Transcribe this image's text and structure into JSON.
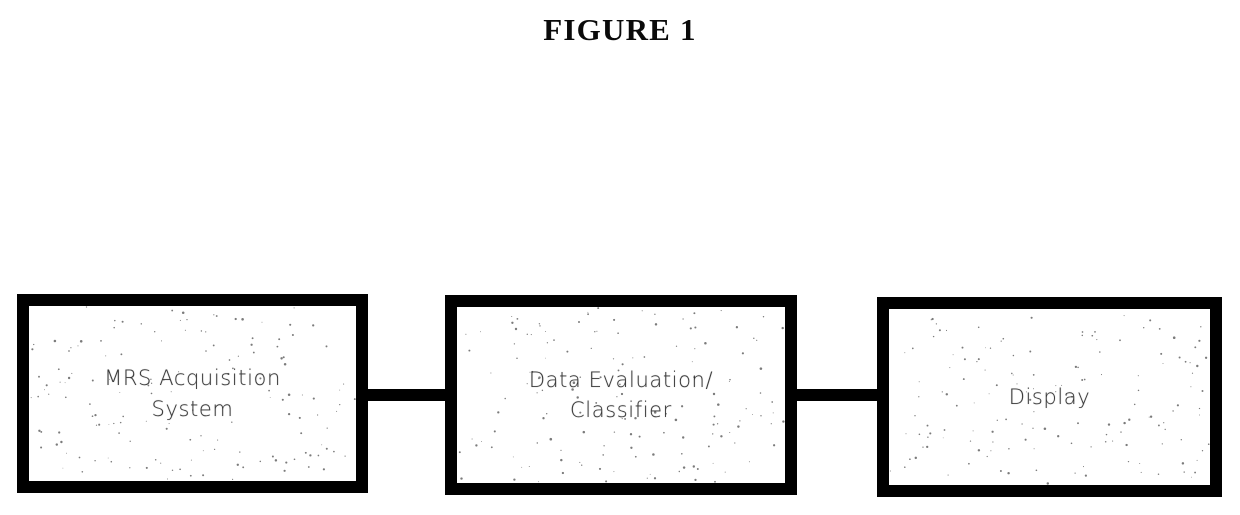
{
  "figure": {
    "title": "FIGURE 1",
    "kind": "block-diagram",
    "background_color": "#ffffff",
    "line_color": "#000000",
    "text_color": "#2b2b2b"
  },
  "chart_data": {
    "type": "diagram",
    "title": "FIGURE 1",
    "nodes": [
      {
        "id": "mrs",
        "label": "MRS Acquisition\nSystem",
        "order": 1
      },
      {
        "id": "evaluator",
        "label": "Data Evaluation/\nClassifier",
        "order": 2
      },
      {
        "id": "display",
        "label": "Display",
        "order": 3
      }
    ],
    "edges": [
      {
        "id": "connector-1",
        "from": "mrs",
        "to": "evaluator",
        "style": "thick-line",
        "arrow": false
      },
      {
        "id": "connector-2",
        "from": "evaluator",
        "to": "display",
        "style": "thick-line",
        "arrow": false
      }
    ]
  },
  "blocks": {
    "mrs": {
      "label": "MRS Acquisition\nSystem"
    },
    "evaluator": {
      "label": "Data Evaluation/\nClassifier"
    },
    "display": {
      "label": "Display"
    }
  }
}
